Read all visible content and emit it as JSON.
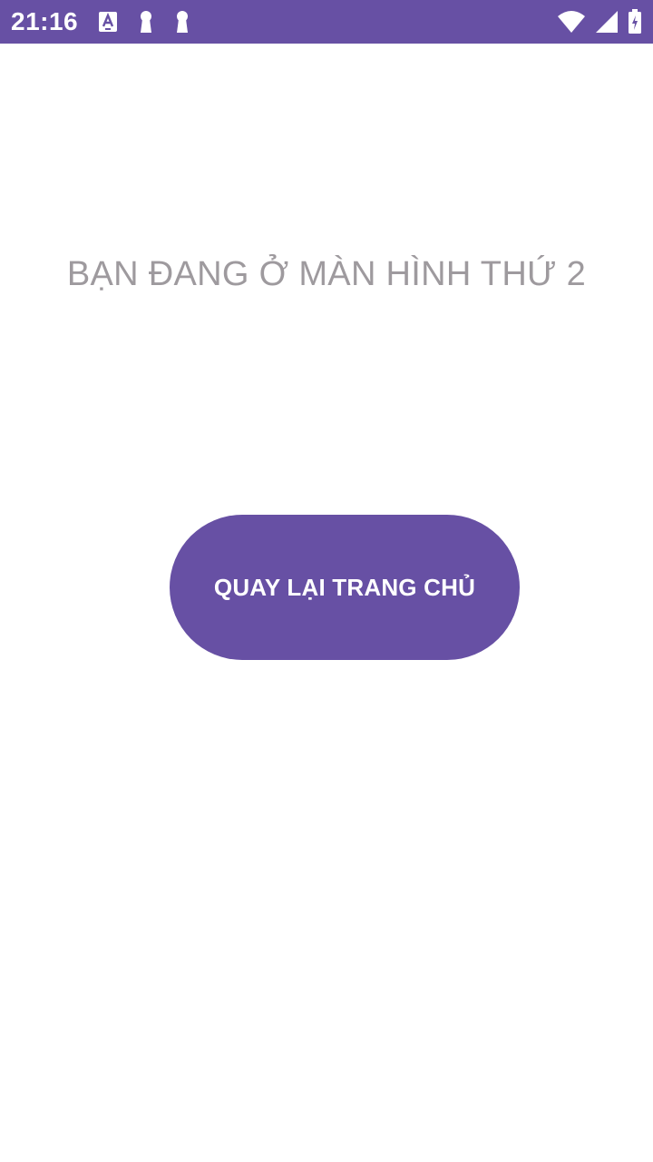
{
  "status_bar": {
    "time": "21:16",
    "background_color": "#6750a4",
    "left_icons": [
      "text-a-icon",
      "keyhole-icon",
      "keyhole-icon"
    ],
    "right_icons": [
      "wifi-icon",
      "cell-signal-icon",
      "battery-charging-icon"
    ]
  },
  "main": {
    "title": "BẠN ĐANG Ở MÀN HÌNH THỨ 2",
    "title_color": "#9e9a9e",
    "back_button_label": "QUAY LẠI TRANG CHỦ",
    "button_color": "#6750a4"
  }
}
